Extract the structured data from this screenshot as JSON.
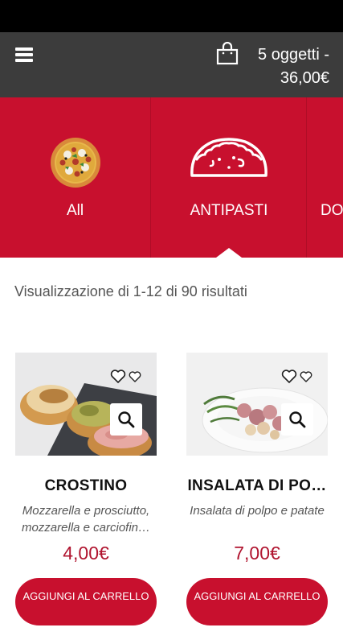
{
  "header": {
    "cart_line1": "5 oggetti -",
    "cart_line2": "36,00€",
    "colors": {
      "bar": "#3c3c3c",
      "icon": "#ffffff"
    },
    "icons": [
      "menu-icon",
      "shopping-bag-icon"
    ]
  },
  "categories": [
    {
      "label": "All",
      "icon": "pizza-icon",
      "active": false
    },
    {
      "label": "ANTIPASTI",
      "icon": "empanada-icon",
      "active": true
    },
    {
      "label": "DO",
      "icon": "",
      "active": false
    }
  ],
  "results": {
    "text": "Visualizzazione di 1-12 di 90 risultati"
  },
  "products": [
    {
      "title": "CROSTINO",
      "description": "Mozzarella e prosciutto, mozzarella e carciofin…",
      "price": "4,00€",
      "button": "AGGIUNGI AL CARRELLO"
    },
    {
      "title": "INSALATA DI PO…",
      "description": "Insalata di polpo e patate",
      "price": "7,00€",
      "button": "AGGIUNGI AL CARRELLO"
    }
  ],
  "theme": {
    "brand_red": "#c8102e",
    "price_red": "#b0142f"
  }
}
